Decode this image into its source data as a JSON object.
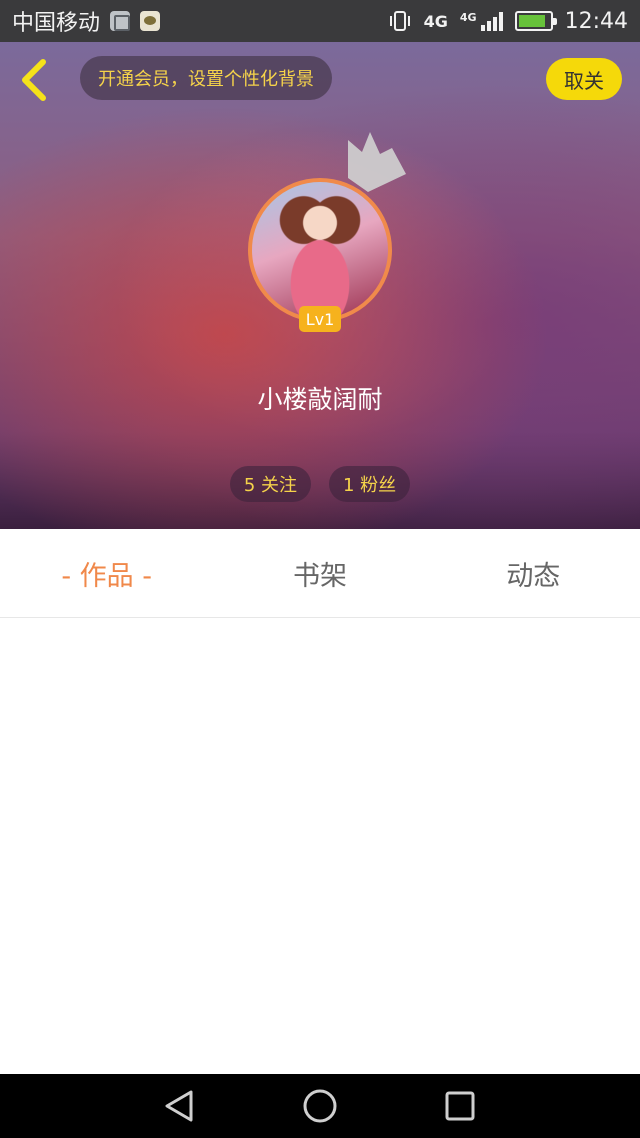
{
  "status_bar": {
    "carrier": "中国移动",
    "network_1": "4G",
    "network_2": "4G",
    "time": "12:44"
  },
  "header": {
    "vip_banner": "开通会员，设置个性化背景",
    "unfollow_label": "取关",
    "level": "Lv1",
    "username": "小楼敲阔耐",
    "following": "5 关注",
    "followers": "1 粉丝"
  },
  "tabs": [
    {
      "label": "作品",
      "active": true
    },
    {
      "label": "书架",
      "active": false
    },
    {
      "label": "动态",
      "active": false
    }
  ],
  "icons": {
    "back": "chevron-left-icon",
    "crown": "crown-icon",
    "nav_back": "triangle-back-icon",
    "nav_home": "circle-home-icon",
    "nav_recent": "square-recent-icon"
  },
  "colors": {
    "accent": "#f0884a",
    "vip_text": "#f5d34a",
    "unfollow_bg": "#f5d90a",
    "level_bg": "#f6b21d"
  }
}
